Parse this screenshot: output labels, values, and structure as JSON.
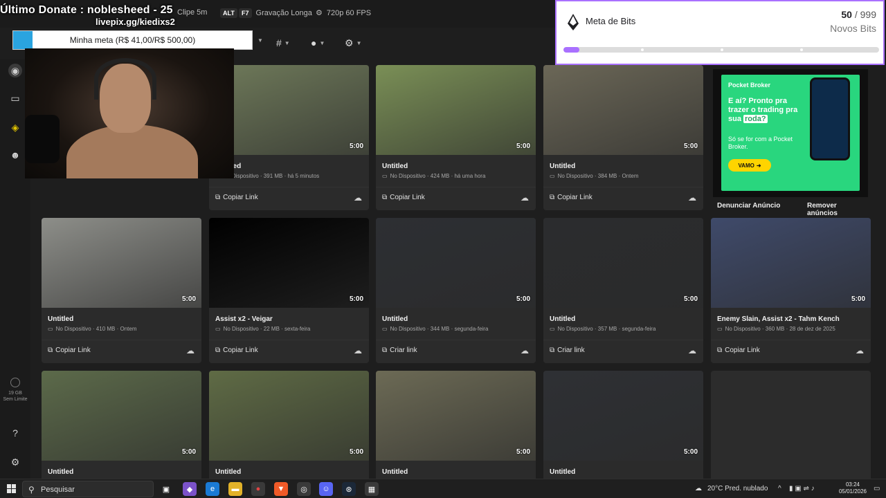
{
  "overlay": {
    "last_donate": "Último Donate : noblesheed - 25",
    "livepix": "livepix.gg/kiedixs2",
    "goal_text": "Minha meta (R$ 41,00/R$ 500,00)",
    "goal_progress": 0.082
  },
  "topbar": {
    "items": [
      {
        "key": "",
        "label": "Clipe 5m"
      },
      {
        "key": "ALT",
        "label": ""
      },
      {
        "key": "F7",
        "label": "Gravação Longa"
      },
      {
        "key": "",
        "label": "720p 60 FPS"
      }
    ]
  },
  "toolbar": {
    "hash_icon": "hash-filter-icon",
    "person_icon": "person-filter-icon",
    "gear_icon": "settings-filter-icon"
  },
  "bits": {
    "title": "Meta de Bits",
    "current": "50",
    "sep": " / ",
    "target": "999",
    "unit": "Novos Bits",
    "progress": 0.05,
    "accent": "#a970ff"
  },
  "sidebar": {
    "storage_size": "19 GB",
    "storage_limit": "Sem Limite"
  },
  "clips": [
    {
      "title": "Untitled",
      "meta": "No Dispositivo · 391 MB · há 5 minutos",
      "duration": "5:00",
      "action": "Copiar Link",
      "thumb": "#6f7a5a"
    },
    {
      "title": "Untitled",
      "meta": "No Dispositivo · 424 MB · há uma hora",
      "duration": "5:00",
      "action": "Copiar Link",
      "thumb": "#7a8f56"
    },
    {
      "title": "Untitled",
      "meta": "No Dispositivo · 384 MB · Ontem",
      "duration": "5:00",
      "action": "Copiar Link",
      "thumb": "#6b6757"
    },
    {
      "title": "Untitled",
      "meta": "No Dispositivo · 410 MB · Ontem",
      "duration": "5:00",
      "action": "Copiar Link",
      "thumb": "#8d8e89"
    },
    {
      "title": "Assist x2 - Veigar",
      "meta": "No Dispositivo · 22 MB · sexta-feira",
      "duration": "5:00",
      "action": "Copiar Link",
      "thumb": "#000000"
    },
    {
      "title": "Untitled",
      "meta": "No Dispositivo · 344 MB · segunda-feira",
      "duration": "5:00",
      "action": "Criar link",
      "thumb": "#2d2f33"
    },
    {
      "title": "Untitled",
      "meta": "No Dispositivo · 357 MB · segunda-feira",
      "duration": "5:00",
      "action": "Criar link",
      "thumb": "#2b2c2e"
    },
    {
      "title": "Enemy Slain, Assist x2 - Tahm Kench",
      "meta": "No Dispositivo · 360 MB · 28 de dez de 2025",
      "duration": "5:00",
      "action": "Copiar Link",
      "thumb": "#3f4a6a"
    },
    {
      "title": "Untitled",
      "meta": "",
      "duration": "5:00",
      "action": "",
      "thumb": "#5c6a4a"
    },
    {
      "title": "Untitled",
      "meta": "",
      "duration": "5:00",
      "action": "",
      "thumb": "#5f6b45"
    },
    {
      "title": "Untitled",
      "meta": "",
      "duration": "5:00",
      "action": "",
      "thumb": "#6c6a55"
    },
    {
      "title": "Untitled",
      "meta": "",
      "duration": "5:00",
      "action": "",
      "thumb": "#2e3034"
    }
  ],
  "ad": {
    "brand": "Pocket Broker",
    "headline_a": "E aí? Pronto pra trazer o trading pra sua",
    "headline_hl": "roda?",
    "sub": "Só se for com a Pocket Broker.",
    "cta": "VAMO",
    "report": "Denunciar Anúncio",
    "remove": "Remover anúncios"
  },
  "taskbar": {
    "search": "Pesquisar",
    "weather": "20°C  Pred. nublado",
    "time": "03:24",
    "date": "05/01/2026"
  }
}
